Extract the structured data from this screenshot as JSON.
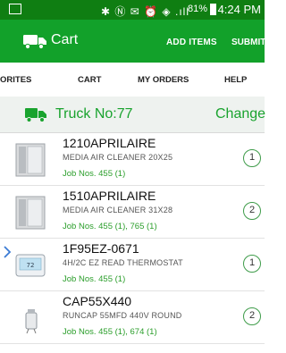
{
  "status_bar": {
    "icons_text": "✱ Ⓝ ✉ ⏰ ◈ .ıll",
    "battery": "81%",
    "time": "4:24 PM"
  },
  "app_bar": {
    "title": "Cart",
    "add_items": "ADD ITEMS",
    "submit": "SUBMIT"
  },
  "tabs": [
    "ORITES",
    "CART",
    "MY ORDERS",
    "HELP"
  ],
  "truck": {
    "label": "Truck No:77",
    "change": "Change"
  },
  "items": [
    {
      "name": "1210APRILAIRE",
      "desc": "MEDIA AIR CLEANER  20X25",
      "jobs": "Job Nos. 455 (1)",
      "qty": "1",
      "icon": "air-cleaner"
    },
    {
      "name": "1510APRILAIRE",
      "desc": "MEDIA AIR CLEANER 31X28",
      "jobs": "Job Nos. 455 (1), 765 (1)",
      "qty": "2",
      "icon": "air-cleaner"
    },
    {
      "name": "1F95EZ-0671",
      "desc": "4H/2C EZ READ THERMOSTAT",
      "jobs": "Job Nos. 455 (1)",
      "qty": "1",
      "icon": "thermostat"
    },
    {
      "name": "CAP55X440",
      "desc": "RUNCAP 55MFD 440V ROUND",
      "jobs": "Job Nos. 455 (1), 674 (1)",
      "qty": "2",
      "icon": "capacitor"
    }
  ],
  "colors": {
    "status": "#0f7e12",
    "accent": "#12a12a",
    "green_text": "#19a32e"
  }
}
